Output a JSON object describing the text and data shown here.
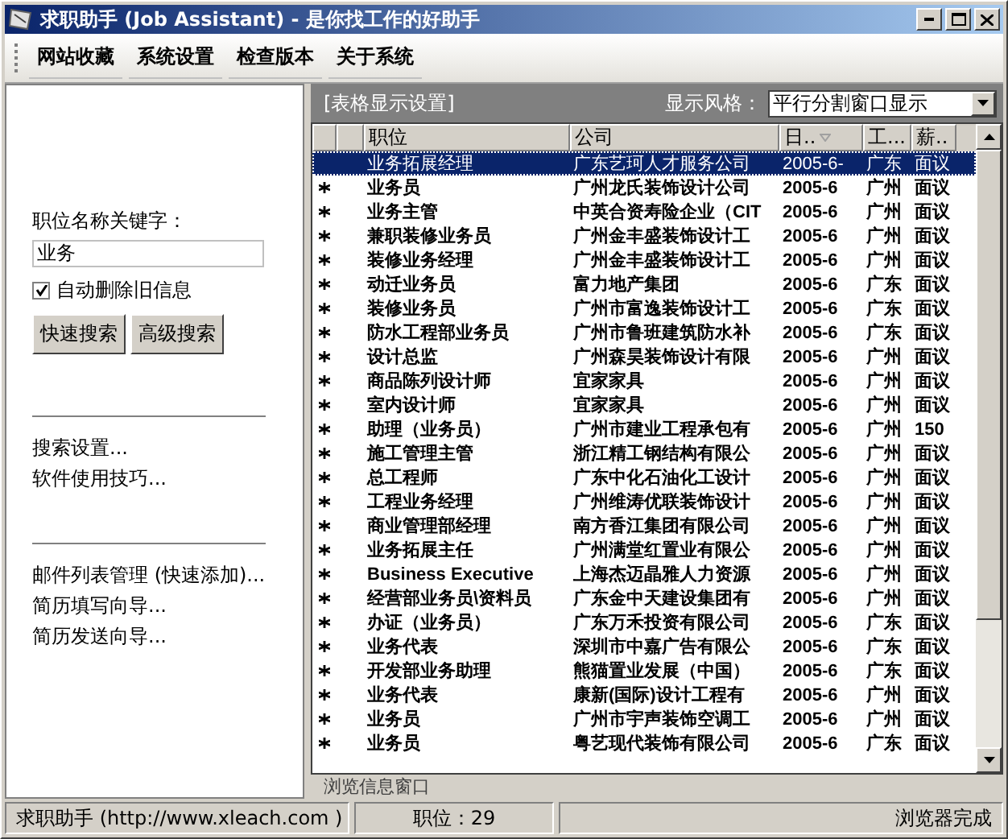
{
  "window": {
    "title": "求职助手 (Job Assistant) - 是你找工作的好助手"
  },
  "menu": [
    "网站收藏",
    "系统设置",
    "检查版本",
    "关于系统"
  ],
  "sidebar": {
    "keyword_label": "职位名称关键字：",
    "keyword_value": "业务",
    "auto_delete": {
      "label": "自动删除旧信息",
      "checked": true
    },
    "buttons": [
      "快速搜索",
      "高级搜索"
    ],
    "link_groups": [
      [
        "搜索设置...",
        "软件使用技巧..."
      ],
      [
        "邮件列表管理 (快速添加)...",
        "简历填写向导...",
        "简历发送向导..."
      ]
    ]
  },
  "table_settings": {
    "label": "[表格显示设置]",
    "style_label": "显示风格：",
    "style_value": "平行分割窗口显示"
  },
  "table": {
    "columns": [
      {
        "label": "职位",
        "sorted": false
      },
      {
        "label": "公司",
        "sorted": false
      },
      {
        "label": "日..",
        "sorted": true
      },
      {
        "label": "工...",
        "sorted": false
      },
      {
        "label": "薪..",
        "sorted": false
      }
    ],
    "rows": [
      {
        "cells": [
          "业务拓展经理",
          "广东艺珂人才服务公司",
          "2005-6-",
          "广东",
          "面议"
        ],
        "selected": true,
        "unread": false
      },
      {
        "cells": [
          "业务员",
          "广州龙氏装饰设计公司",
          "2005-6",
          "广州",
          "面议"
        ],
        "selected": false,
        "unread": true
      },
      {
        "cells": [
          "业务主管",
          "中英合资寿险企业（CIT",
          "2005-6",
          "广州",
          "面议"
        ],
        "selected": false,
        "unread": true
      },
      {
        "cells": [
          "兼职装修业务员",
          "广州金丰盛装饰设计工",
          "2005-6",
          "广州",
          "面议"
        ],
        "selected": false,
        "unread": true
      },
      {
        "cells": [
          "装修业务经理",
          "广州金丰盛装饰设计工",
          "2005-6",
          "广州",
          "面议"
        ],
        "selected": false,
        "unread": true
      },
      {
        "cells": [
          "动迁业务员",
          "富力地产集团",
          "2005-6",
          "广东",
          "面议"
        ],
        "selected": false,
        "unread": true
      },
      {
        "cells": [
          "装修业务员",
          "广州市富逸装饰设计工",
          "2005-6",
          "广东",
          "面议"
        ],
        "selected": false,
        "unread": true
      },
      {
        "cells": [
          "防水工程部业务员",
          "广州市鲁班建筑防水补",
          "2005-6",
          "广东",
          "面议"
        ],
        "selected": false,
        "unread": true
      },
      {
        "cells": [
          "设计总监",
          "广州森昊装饰设计有限",
          "2005-6",
          "广州",
          "面议"
        ],
        "selected": false,
        "unread": true
      },
      {
        "cells": [
          "商品陈列设计师",
          "宜家家具",
          "2005-6",
          "广州",
          "面议"
        ],
        "selected": false,
        "unread": true
      },
      {
        "cells": [
          "室内设计师",
          "宜家家具",
          "2005-6",
          "广州",
          "面议"
        ],
        "selected": false,
        "unread": true
      },
      {
        "cells": [
          "助理（业务员）",
          "广州市建业工程承包有",
          "2005-6",
          "广州",
          "150"
        ],
        "selected": false,
        "unread": true
      },
      {
        "cells": [
          "施工管理主管",
          "浙江精工钢结构有限公",
          "2005-6",
          "广州",
          "面议"
        ],
        "selected": false,
        "unread": true
      },
      {
        "cells": [
          "总工程师",
          "广东中化石油化工设计",
          "2005-6",
          "广州",
          "面议"
        ],
        "selected": false,
        "unread": true
      },
      {
        "cells": [
          "工程业务经理",
          "广州维涛优联装饰设计",
          "2005-6",
          "广州",
          "面议"
        ],
        "selected": false,
        "unread": true
      },
      {
        "cells": [
          "商业管理部经理",
          "南方香江集团有限公司",
          "2005-6",
          "广州",
          "面议"
        ],
        "selected": false,
        "unread": true
      },
      {
        "cells": [
          "业务拓展主任",
          "广州满堂红置业有限公",
          "2005-6",
          "广州",
          "面议"
        ],
        "selected": false,
        "unread": true
      },
      {
        "cells": [
          "Business Executive",
          "上海杰迈晶雅人力资源",
          "2005-6",
          "广州",
          "面议"
        ],
        "selected": false,
        "unread": true
      },
      {
        "cells": [
          "经营部业务员\\资料员",
          "广东金中天建设集团有",
          "2005-6",
          "广州",
          "面议"
        ],
        "selected": false,
        "unread": true
      },
      {
        "cells": [
          "办证（业务员）",
          "广东万禾投资有限公司",
          "2005-6",
          "广东",
          "面议"
        ],
        "selected": false,
        "unread": true
      },
      {
        "cells": [
          "业务代表",
          "深圳市中嘉广告有限公",
          "2005-6",
          "广东",
          "面议"
        ],
        "selected": false,
        "unread": true
      },
      {
        "cells": [
          "开发部业务助理",
          "熊猫置业发展（中国）",
          "2005-6",
          "广东",
          "面议"
        ],
        "selected": false,
        "unread": true
      },
      {
        "cells": [
          "业务代表",
          "康新(国际)设计工程有",
          "2005-6",
          "广州",
          "面议"
        ],
        "selected": false,
        "unread": true
      },
      {
        "cells": [
          "业务员",
          "广州市宇声装饰空调工",
          "2005-6",
          "广州",
          "面议"
        ],
        "selected": false,
        "unread": true
      },
      {
        "cells": [
          "业务员",
          "粤艺现代装饰有限公司",
          "2005-6",
          "广东",
          "面议"
        ],
        "selected": false,
        "unread": true
      }
    ]
  },
  "info_pane": {
    "title": "浏览信息窗口"
  },
  "status_bar": [
    "求职助手 (http://www.xleach.com )",
    "职位：29",
    "浏览器完成"
  ]
}
